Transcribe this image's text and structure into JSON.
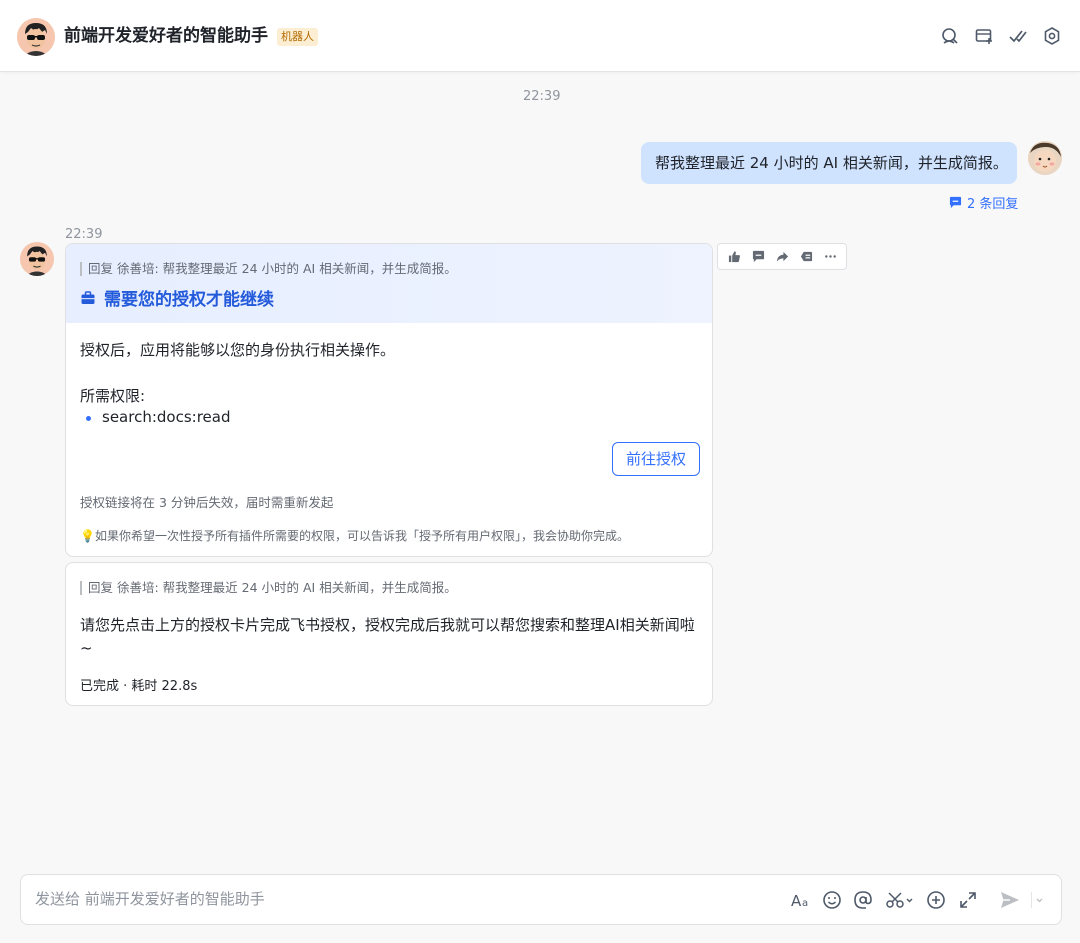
{
  "header": {
    "title": "前端开发爱好者的智能助手",
    "badge": "机器人",
    "icons": [
      "search-icon",
      "new-chat-icon",
      "check-icon",
      "settings-icon"
    ]
  },
  "chat": {
    "timestamp_top": "22:39",
    "user_message": "帮我整理最近 24 小时的 AI 相关新闻，并生成简报。",
    "reply_count": "2 条回复",
    "bot_timestamp": "22:39",
    "auth_card": {
      "quote": "回复 徐善培: 帮我整理最近 24 小时的 AI 相关新闻，并生成简报。",
      "title": "需要您的授权才能继续",
      "description": "授权后，应用将能够以您的身份执行相关操作。",
      "permissions_label": "所需权限:",
      "permissions": [
        "search:docs:read"
      ],
      "button_label": "前往授权",
      "expiry_note": "授权链接将在 3 分钟后失效，届时需重新发起",
      "tip": "💡如果你希望一次性授予所有插件所需要的权限，可以告诉我「授予所有用户权限」，我会协助你完成。"
    },
    "reply_card": {
      "quote": "回复 徐善培: 帮我整理最近 24 小时的 AI 相关新闻，并生成简报。",
      "line1": "请您先点击上方的授权卡片完成飞书授权，授权完成后我就可以帮您搜索和整理AI相关新闻啦",
      "line2": "~",
      "status": "已完成 · 耗时 22.8s"
    }
  },
  "input": {
    "placeholder": "发送给 前端开发爱好者的智能助手"
  },
  "colors": {
    "accent": "#3370ff",
    "user_bubble": "#cfe2fe",
    "badge_bg": "#fbeed2",
    "badge_text": "#b56a00"
  }
}
